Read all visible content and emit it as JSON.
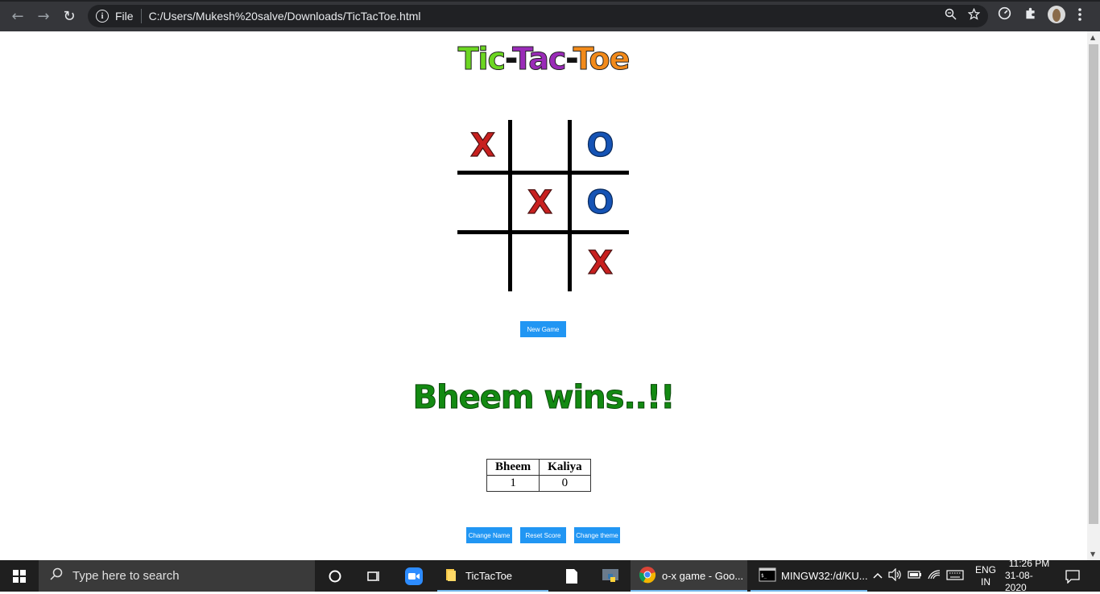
{
  "browser": {
    "nav": {
      "back": "←",
      "forward": "→",
      "reload": "↻"
    },
    "info_icon": "i",
    "scheme_label": "File",
    "url": "C:/Users/Mukesh%20salve/Downloads/TicTacToe.html",
    "right_icons": [
      "zoom-icon",
      "star-icon"
    ],
    "extension_icons": [
      "dashboard-icon",
      "puzzle-icon",
      "avatar",
      "menu-icon"
    ]
  },
  "game": {
    "title_parts": {
      "tic": "Tic",
      "dash1": "-",
      "tac": "Tac",
      "dash2": "-",
      "toe": "Toe"
    },
    "board": [
      "X",
      "",
      "O",
      "",
      "X",
      "O",
      "",
      "",
      "X"
    ],
    "new_game_label": "New Game",
    "winner_text": "Bheem wins..!!",
    "scoreboard": {
      "headers": [
        "Bheem",
        "Kaliya"
      ],
      "scores": [
        "1",
        "0"
      ]
    },
    "buttons": {
      "change_name": "Change Name",
      "reset_score": "Reset Score",
      "change_theme": "Change theme"
    },
    "colors": {
      "x": "#c8201f",
      "o": "#1553b5",
      "button": "#2196f3",
      "winner": "#138a12"
    }
  },
  "taskbar": {
    "search_placeholder": "Type here to search",
    "apps": [
      {
        "label": "TicTacToe",
        "icon": "folder-icon"
      },
      {
        "label": "o-x game - Goo...",
        "icon": "chrome-icon"
      },
      {
        "label": "MINGW32:/d/KU...",
        "icon": "terminal-icon"
      }
    ],
    "lang_top": "ENG",
    "lang_bottom": "IN",
    "time": "11:26 PM",
    "date": "31-08-2020"
  }
}
